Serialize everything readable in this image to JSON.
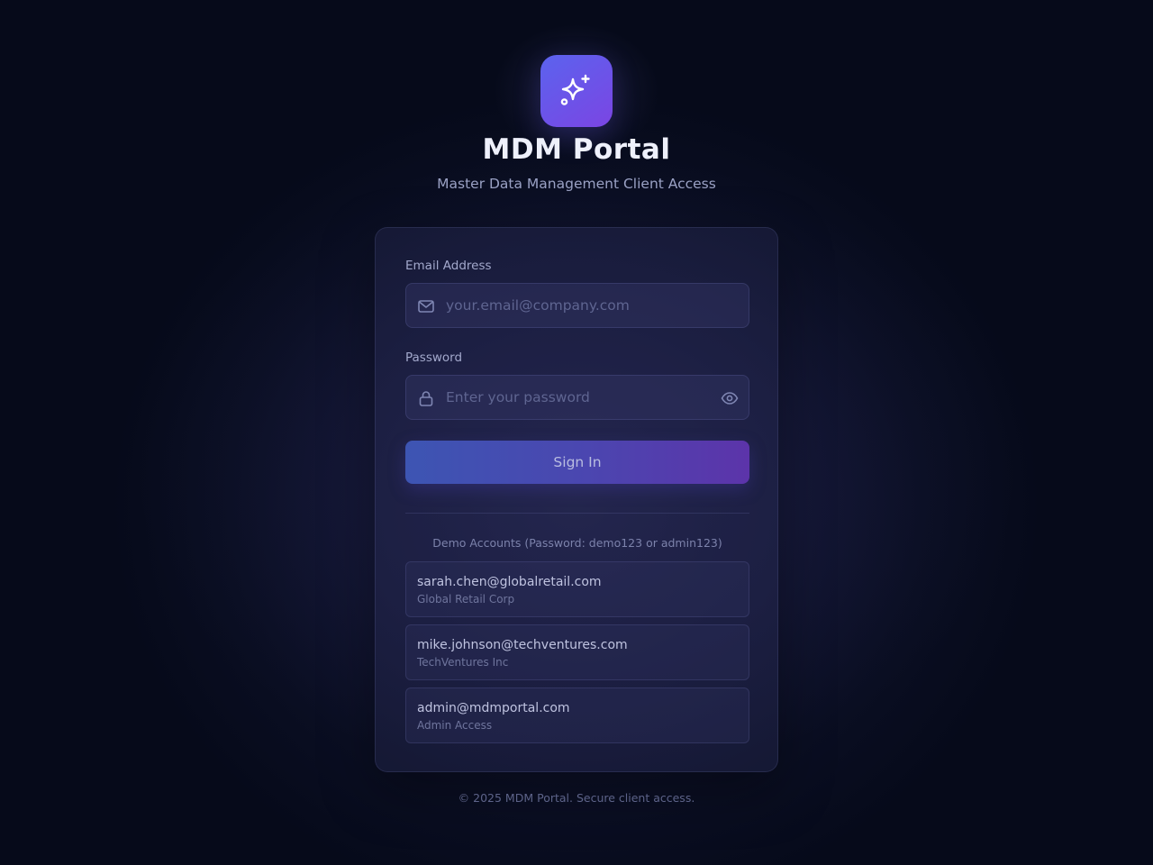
{
  "brand": {
    "icon": "sparkles-icon",
    "title": "MDM Portal",
    "subtitle": "Master Data Management Client Access",
    "gradient_start": "#5b63ee",
    "gradient_end": "#7b45e3"
  },
  "form": {
    "email": {
      "label": "Email Address",
      "placeholder": "your.email@company.com",
      "value": "",
      "icon": "mail-icon"
    },
    "password": {
      "label": "Password",
      "placeholder": "Enter your password",
      "value": "",
      "icon": "lock-icon",
      "toggle_icon": "eye-icon"
    },
    "submit_label": "Sign In"
  },
  "demo": {
    "title": "Demo Accounts (Password: demo123 or admin123)",
    "accounts": [
      {
        "email": "sarah.chen@globalretail.com",
        "org": "Global Retail Corp"
      },
      {
        "email": "mike.johnson@techventures.com",
        "org": "TechVentures Inc"
      },
      {
        "email": "admin@mdmportal.com",
        "org": "Admin Access"
      }
    ]
  },
  "footer": "© 2025 MDM Portal. Secure client access."
}
